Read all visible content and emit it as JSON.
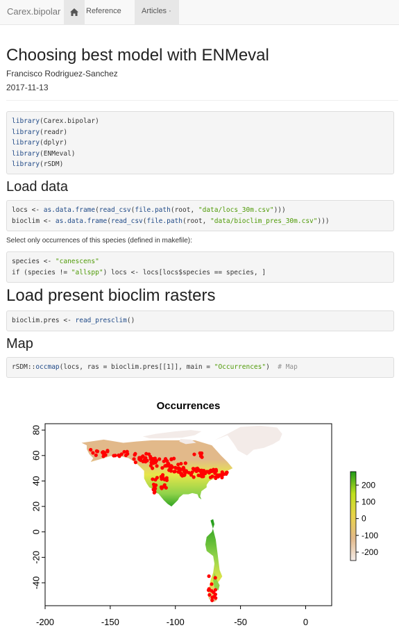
{
  "navbar": {
    "brand": "Carex.bipolar",
    "reference": "Reference",
    "articles": "Articles ·"
  },
  "article": {
    "title": "Choosing best model with ENMeval",
    "author": "Francisco Rodriguez-Sanchez",
    "date": "2017-11-13"
  },
  "code1": {
    "fn": "library",
    "pkgs": [
      "(Carex.bipolar)",
      "(readr)",
      "(dplyr)",
      "(ENMeval)",
      "(rSDM)"
    ]
  },
  "section1": "Load data",
  "code2": {
    "l1a": "locs <- ",
    "l1b": "as.data.frame",
    "l1c": "(",
    "l1d": "read_csv",
    "l1e": "(",
    "l1f": "file.path",
    "l1g": "(root, ",
    "l1h": "\"data/locs_30m.csv\"",
    "l1i": ")))",
    "l2a": "bioclim <- ",
    "l2b": "as.data.frame",
    "l2c": "(",
    "l2d": "read_csv",
    "l2e": "(",
    "l2f": "file.path",
    "l2g": "(root, ",
    "l2h": "\"data/bioclim_pres_30m.csv\"",
    "l2i": ")))"
  },
  "para1": "Select only occurrences of this species (defined in makefile):",
  "code3": {
    "l1a": "species <- ",
    "l1b": "\"canescens\"",
    "l2a": "if (species != ",
    "l2b": "\"allspp\"",
    "l2c": ") locs <- locs[locs$species == species, ]"
  },
  "section2": "Load present bioclim rasters",
  "code4": {
    "a": "bioclim.pres <- ",
    "b": "read_presclim",
    "c": "()"
  },
  "section3": "Map",
  "code5": {
    "a": "rSDM::",
    "b": "occmap",
    "c": "(locs, ras = bioclim.pres[[1]], main = ",
    "d": "\"Occurrences\"",
    "e": ")  ",
    "f": "# Map"
  },
  "chart_data": {
    "type": "raster-map",
    "title": "Occurrences",
    "xlabel": "",
    "ylabel": "",
    "xlim": [
      -200,
      20
    ],
    "ylim": [
      -58,
      85
    ],
    "x_ticks": [
      -200,
      -150,
      -100,
      -50,
      0
    ],
    "y_ticks": [
      -40,
      -20,
      0,
      20,
      40,
      60,
      80
    ],
    "legend": {
      "ticks": [
        200,
        100,
        0,
        -100,
        -200
      ],
      "range": [
        -250,
        280
      ],
      "colors": [
        "#f3ebe8",
        "#e2b98a",
        "#e9d34a",
        "#bfe01d",
        "#1f9b1a"
      ]
    },
    "raster_colors": {
      "cold": "#f3ebe8",
      "boreal": "#e2b98a",
      "temperate": "#e7e64a",
      "warm": "#8fd24a",
      "tropical": "#1f9b1a"
    },
    "points_color": "#ff0000"
  }
}
